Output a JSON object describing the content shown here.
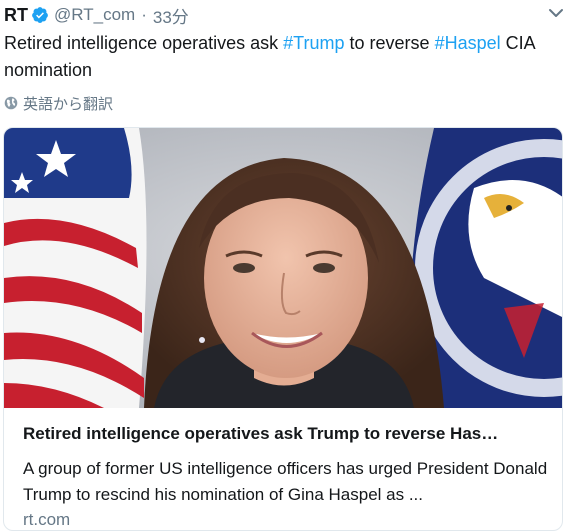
{
  "tweet": {
    "author_name": "RT",
    "handle": "@RT_com",
    "separator": "·",
    "time": "33分",
    "text_before": "Retired intelligence operatives ask ",
    "hashtag_1": "#Trump",
    "text_middle": " to reverse ",
    "hashtag_2": "#Haspel",
    "text_after": " CIA nomination",
    "translate_label": "英語から翻訳",
    "icons": {
      "verified": "verified-badge-icon",
      "caret": "chevron-down-icon",
      "translate": "globe-icon"
    }
  },
  "card": {
    "title": "Retired intelligence operatives ask Trump to reverse Has…",
    "description": "A group of former US intelligence officers has urged President Donald Trump to rescind his nomination of Gina Haspel as ...",
    "domain": "rt.com"
  },
  "colors": {
    "accent": "#1da1f2",
    "text": "#14171a",
    "muted": "#657786",
    "border": "#e1e8ed"
  }
}
